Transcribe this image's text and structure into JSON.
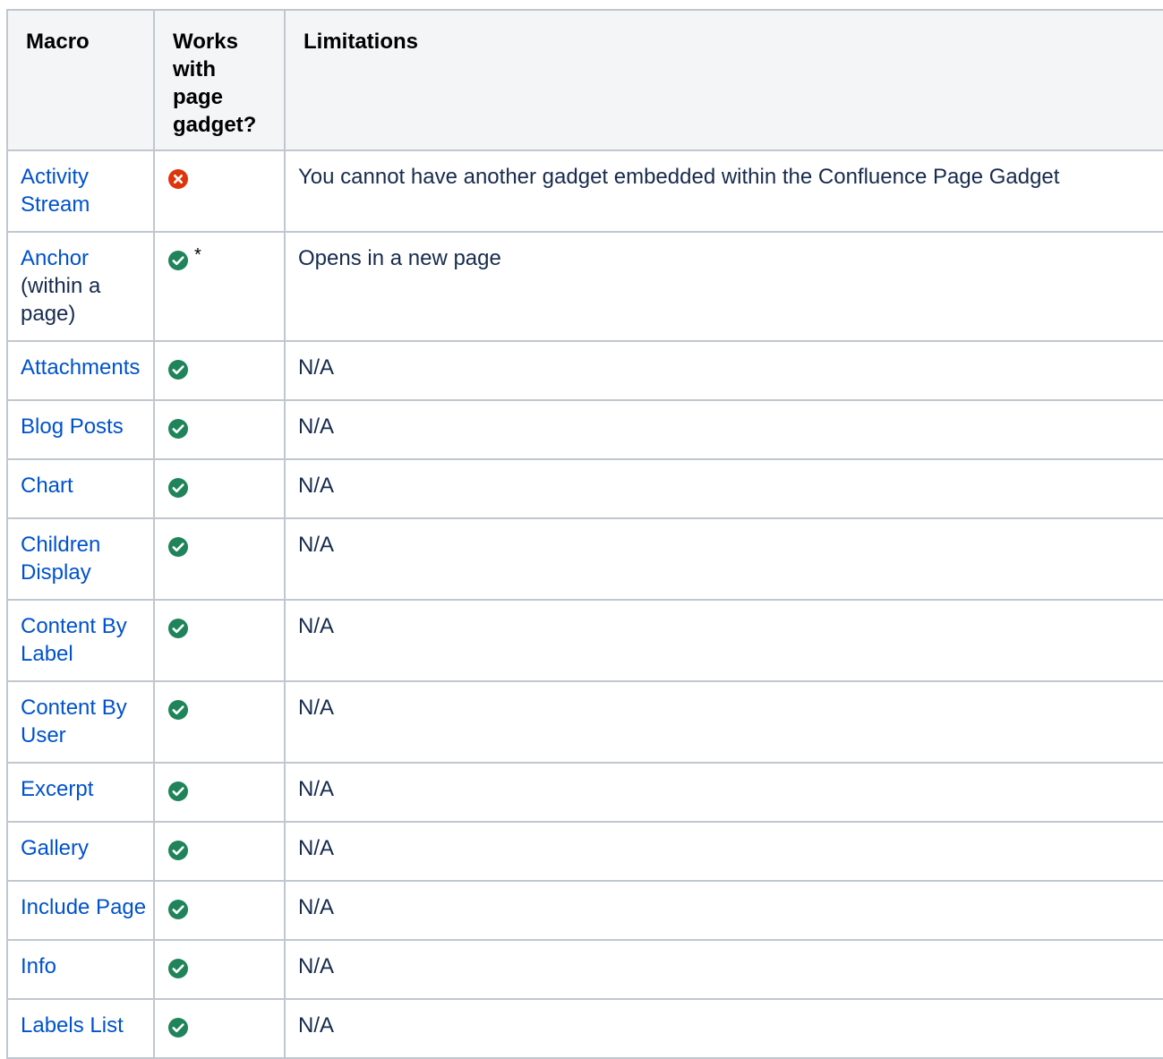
{
  "header": {
    "macro": "Macro",
    "works": "Works with page gadget?",
    "limitations": "Limitations"
  },
  "rows": [
    {
      "macro": "Activity Stream",
      "sub": "",
      "status": "no",
      "footnote": "",
      "limitations": "You cannot have another gadget embedded within the Confluence Page Gadget"
    },
    {
      "macro": "Anchor",
      "sub": "(within a page)",
      "status": "yes",
      "footnote": "*",
      "limitations": "Opens in a new page"
    },
    {
      "macro": "Attachments",
      "sub": "",
      "status": "yes",
      "footnote": "",
      "limitations": "N/A"
    },
    {
      "macro": "Blog Posts",
      "sub": "",
      "status": "yes",
      "footnote": "",
      "limitations": "N/A"
    },
    {
      "macro": "Chart",
      "sub": "",
      "status": "yes",
      "footnote": "",
      "limitations": "N/A"
    },
    {
      "macro": "Children Display",
      "sub": "",
      "status": "yes",
      "footnote": "",
      "limitations": "N/A"
    },
    {
      "macro": "Content By Label",
      "sub": "",
      "status": "yes",
      "footnote": "",
      "limitations": "N/A"
    },
    {
      "macro": "Content By User",
      "sub": "",
      "status": "yes",
      "footnote": "",
      "limitations": "N/A"
    },
    {
      "macro": "Excerpt",
      "sub": "",
      "status": "yes",
      "footnote": "",
      "limitations": "N/A"
    },
    {
      "macro": "Gallery",
      "sub": "",
      "status": "yes",
      "footnote": "",
      "limitations": "N/A"
    },
    {
      "macro": "Include Page",
      "sub": "",
      "status": "yes",
      "footnote": "",
      "limitations": "N/A"
    },
    {
      "macro": "Info",
      "sub": "",
      "status": "yes",
      "footnote": "",
      "limitations": "N/A"
    },
    {
      "macro": "Labels List",
      "sub": "",
      "status": "yes",
      "footnote": "",
      "limitations": "N/A"
    }
  ],
  "icons": {
    "yes": {
      "name": "check-circle-icon",
      "color": "#1f845a"
    },
    "no": {
      "name": "error-circle-icon",
      "color": "#de350b"
    }
  },
  "colors": {
    "link": "#0052cc",
    "header_bg": "#f4f5f7",
    "border": "#c1c7d0"
  }
}
